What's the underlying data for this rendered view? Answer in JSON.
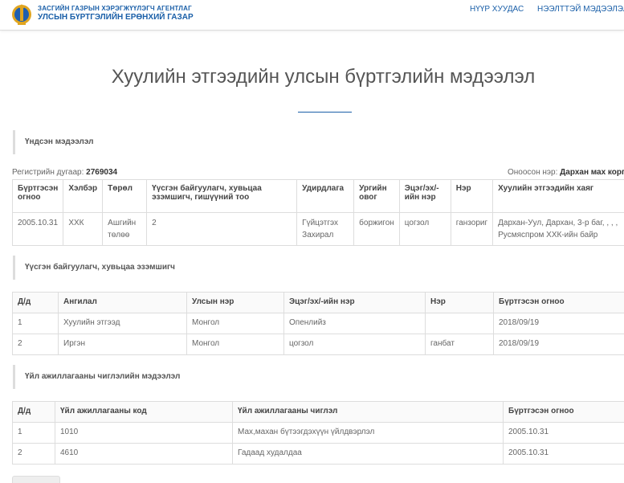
{
  "header": {
    "org_line1": "ЗАСГИЙН ГАЗРЫН ХЭРЭГЖҮҮЛЭГЧ АГЕНТЛАГ",
    "org_line2": "УЛСЫН БҮРТГЭЛИЙН ЕРӨНХИЙ ГАЗАР",
    "nav_home": "НҮҮР ХУУДАС",
    "nav_open": "НЭЭЛТТЭЙ МЭДЭЭЛЭЛ"
  },
  "page": {
    "title": "Хуулийн этгээдийн улсын бүртгэлийн мэдээлэл"
  },
  "basic": {
    "section_title": "Үндсэн мэдээлэл",
    "reg_label": "Регистрийн дугаар:",
    "reg_value": "2769034",
    "short_name_label": "Оноосон нэр:",
    "short_name_value": "Дархан мах корпо",
    "columns": [
      "Бүртгэсэн огноо",
      "Хэлбэр",
      "Төрөл",
      "Үүсгэн байгуулагч, хувьцаа эзэмшигч, гишүүний тоо",
      "Удирдлага",
      "Ургийн овог",
      "Эцэг/эх/-ийн нэр",
      "Нэр",
      "Хуулийн этгээдийн хаяг"
    ],
    "row": [
      "2005.10.31",
      "ХХК",
      "Ашгийн төлөө",
      "2",
      "Гүйцэтгэх Захирал",
      "боржигон",
      "цогзол",
      "ганзориг",
      "Дархан-Уул, Дархан, 3-р баг, , , , Русмяспром ХХК-ийн байр"
    ]
  },
  "founders": {
    "section_title": "Үүсгэн байгуулагч, хувьцаа эзэмшигч",
    "columns": [
      "Д/д",
      "Ангилал",
      "Улсын нэр",
      "Эцэг/эх/-ийн нэр",
      "Нэр",
      "Бүртгэсэн огноо"
    ],
    "rows": [
      [
        "1",
        "Хуулийн этгээд",
        "Монгол",
        "Опенлийз",
        "",
        "2018/09/19"
      ],
      [
        "2",
        "Иргэн",
        "Монгол",
        "цогзол",
        "ганбат",
        "2018/09/19"
      ]
    ]
  },
  "activities": {
    "section_title": "Үйл ажиллагааны чиглэлийн мэдээлэл",
    "columns": [
      "Д/д",
      "Үйл ажиллагааны код",
      "Үйл ажиллагааны чиглэл",
      "Бүртгэсэн огноо"
    ],
    "rows": [
      [
        "1",
        "1010",
        "Мах,махан бүтээгдэхүүн үйлдвэрлэл",
        "2005.10.31"
      ],
      [
        "2",
        "4610",
        "Гадаад худалдаа",
        "2005.10.31"
      ]
    ]
  },
  "colors": {
    "brand_blue": "#1a5fa8",
    "emblem_gold": "#e0a520",
    "emblem_blue": "#1f5fb0"
  }
}
